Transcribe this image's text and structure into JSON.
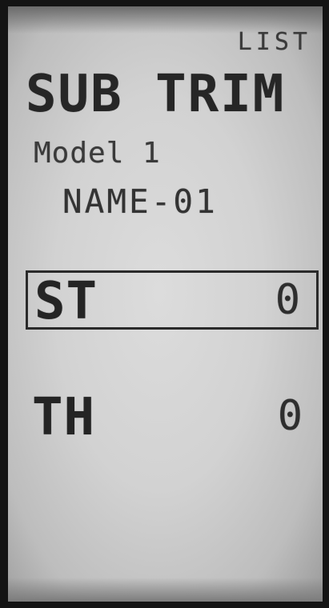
{
  "header": {
    "mode_label": "LIST",
    "screen_title": "SUB TRIM"
  },
  "model": {
    "label": "Model 1",
    "name": "NAME-01"
  },
  "channels": [
    {
      "label": "ST",
      "value": "0",
      "selected": true
    },
    {
      "label": "TH",
      "value": "0",
      "selected": false
    }
  ]
}
